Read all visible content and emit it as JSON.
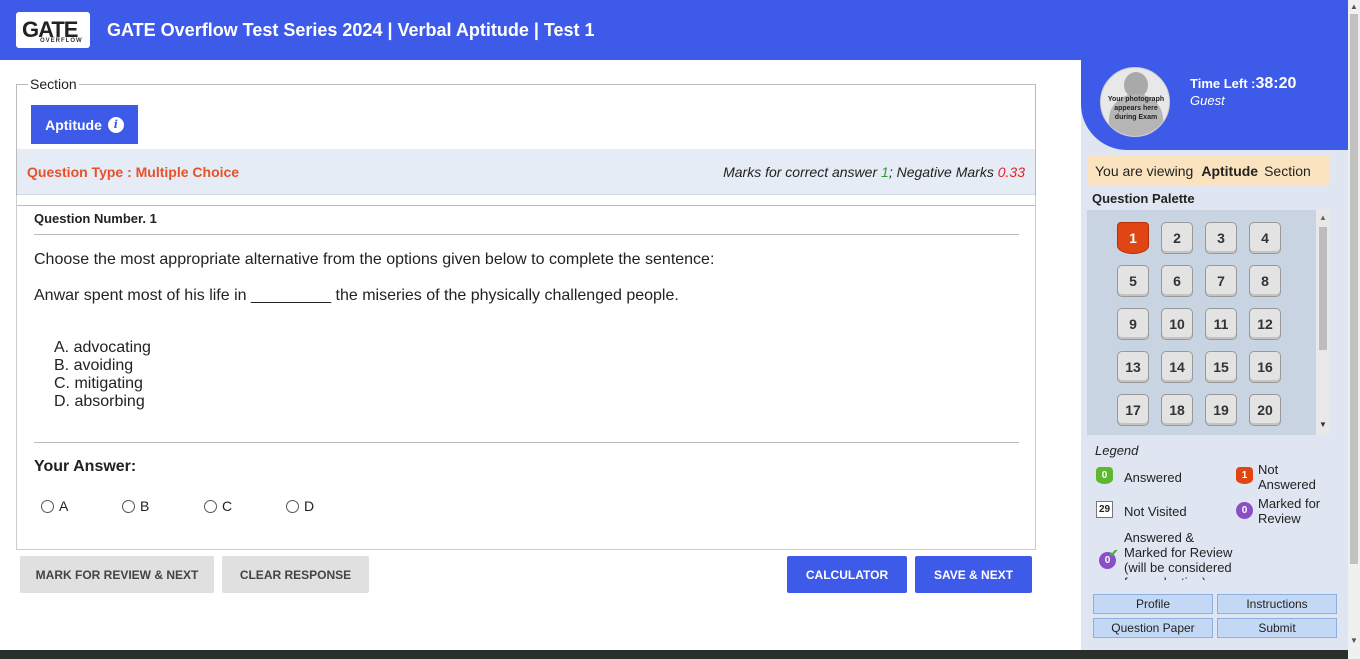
{
  "header": {
    "logo_text": "GATE",
    "logo_sub": "OVERFLOW",
    "title": "GATE Overflow Test Series 2024 | Verbal Aptitude | Test 1"
  },
  "section": {
    "legend": "Section",
    "tab_label": "Aptitude",
    "info_icon": "i"
  },
  "question_meta": {
    "type_label": "Question Type : Multiple Choice",
    "marks_prefix": "Marks for correct answer ",
    "marks_correct": "1",
    "marks_sep": "; Negative Marks ",
    "marks_negative": "0.33"
  },
  "question": {
    "number_label": "Question Number. 1",
    "text": "Choose the most appropriate alternative from the options given below to complete the sentence:",
    "sentence": "Anwar spent most of his life in _________ the miseries of the physically challenged people.",
    "options": [
      "A. advocating",
      "B. avoiding",
      "C. mitigating",
      "D. absorbing"
    ]
  },
  "answer": {
    "label": "Your Answer:",
    "choices": [
      "A",
      "B",
      "C",
      "D"
    ]
  },
  "actions": {
    "mark_review": "MARK FOR REVIEW & NEXT",
    "clear": "CLEAR RESPONSE",
    "calculator": "CALCULATOR",
    "save_next": "SAVE & NEXT"
  },
  "sidebar": {
    "photo_caption": "Your photograph appears here during Exam",
    "time_label": "Time Left :",
    "time_value": "38:20",
    "user": "Guest",
    "viewing_prefix": "You are viewing",
    "viewing_section": "Aptitude",
    "viewing_suffix": "Section",
    "palette_title": "Question Palette",
    "palette": [
      "1",
      "2",
      "3",
      "4",
      "5",
      "6",
      "7",
      "8",
      "9",
      "10",
      "11",
      "12",
      "13",
      "14",
      "15",
      "16",
      "17",
      "18",
      "19",
      "20"
    ],
    "current_question": "1",
    "legend_title": "Legend",
    "legend": {
      "answered": "Answered",
      "answered_count": "0",
      "not_answered": "Not Answered",
      "not_answered_count": "1",
      "not_visited": "Not Visited",
      "not_visited_count": "29",
      "marked_review": "Marked for Review",
      "marked_review_count": "0",
      "answered_marked": "Answered & Marked for Review (will be considered for evaluation)",
      "answered_marked_count": "0"
    },
    "buttons": {
      "profile": "Profile",
      "instructions": "Instructions",
      "question_paper": "Question Paper",
      "submit": "Submit"
    }
  },
  "colors": {
    "brand_blue": "#3d5ae8",
    "not_answered": "#e04513",
    "answered": "#5cb92f",
    "review": "#8a4fc5",
    "question_type": "#e8502a"
  }
}
